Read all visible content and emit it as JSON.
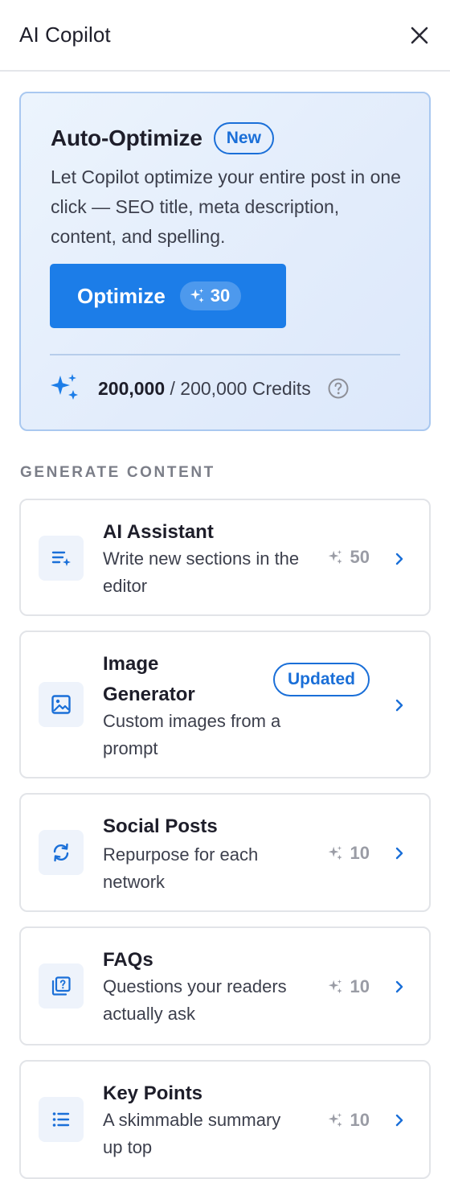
{
  "header": {
    "title": "AI Copilot",
    "close_icon": "close-icon"
  },
  "promo": {
    "title": "Auto-Optimize",
    "badge": "New",
    "description": "Let Copilot optimize your entire post in one click — SEO title, meta description, content, and spelling.",
    "button_label": "Optimize",
    "button_cost": "30",
    "credits_used": "200,000",
    "credits_total": "/ 200,000 Credits",
    "credits_icon": "sparkles-icon",
    "help_icon": "question-circle-icon"
  },
  "section_label": "GENERATE CONTENT",
  "tools": [
    {
      "title": "AI Assistant",
      "description": "Write new sections in the editor",
      "cost": "50",
      "icon": "text-sparkle-icon"
    },
    {
      "title": "Image Generator",
      "description": "Custom images from a prompt",
      "badge": "Updated",
      "icon": "image-icon"
    },
    {
      "title": "Social Posts",
      "description": "Repurpose for each network",
      "cost": "10",
      "icon": "refresh-icon"
    },
    {
      "title": "FAQs",
      "description": "Questions your readers actually ask",
      "cost": "10",
      "icon": "question-square-icon"
    },
    {
      "title": "Key Points",
      "description": "A skimmable summary up top",
      "cost": "10",
      "icon": "list-icon"
    }
  ],
  "colors": {
    "accent": "#1c7de8",
    "badge_blue": "#1a6fd8",
    "promo_border": "#a9c8f0",
    "muted": "#9a9ca5"
  }
}
